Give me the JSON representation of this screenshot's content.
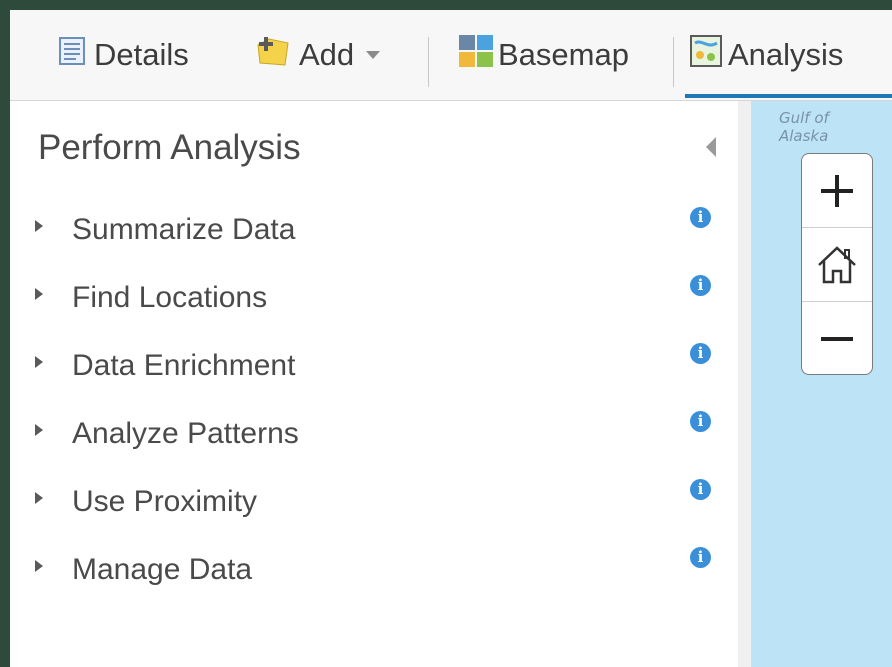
{
  "toolbar": {
    "details_label": "Details",
    "add_label": "Add",
    "basemap_label": "Basemap",
    "analysis_label": "Analysis",
    "active_tab": "Analysis",
    "accent_color": "#1f78b4"
  },
  "panel": {
    "title": "Perform Analysis",
    "items": [
      {
        "label": "Summarize Data"
      },
      {
        "label": "Find Locations"
      },
      {
        "label": "Data Enrichment"
      },
      {
        "label": "Analyze Patterns"
      },
      {
        "label": "Use Proximity"
      },
      {
        "label": "Manage Data"
      }
    ],
    "info_glyph": "i"
  },
  "map": {
    "label_line1": "Gulf of",
    "label_line2": "Alaska",
    "zoom_in_icon": "plus-icon",
    "home_icon": "home-icon",
    "zoom_out_icon": "minus-icon"
  }
}
